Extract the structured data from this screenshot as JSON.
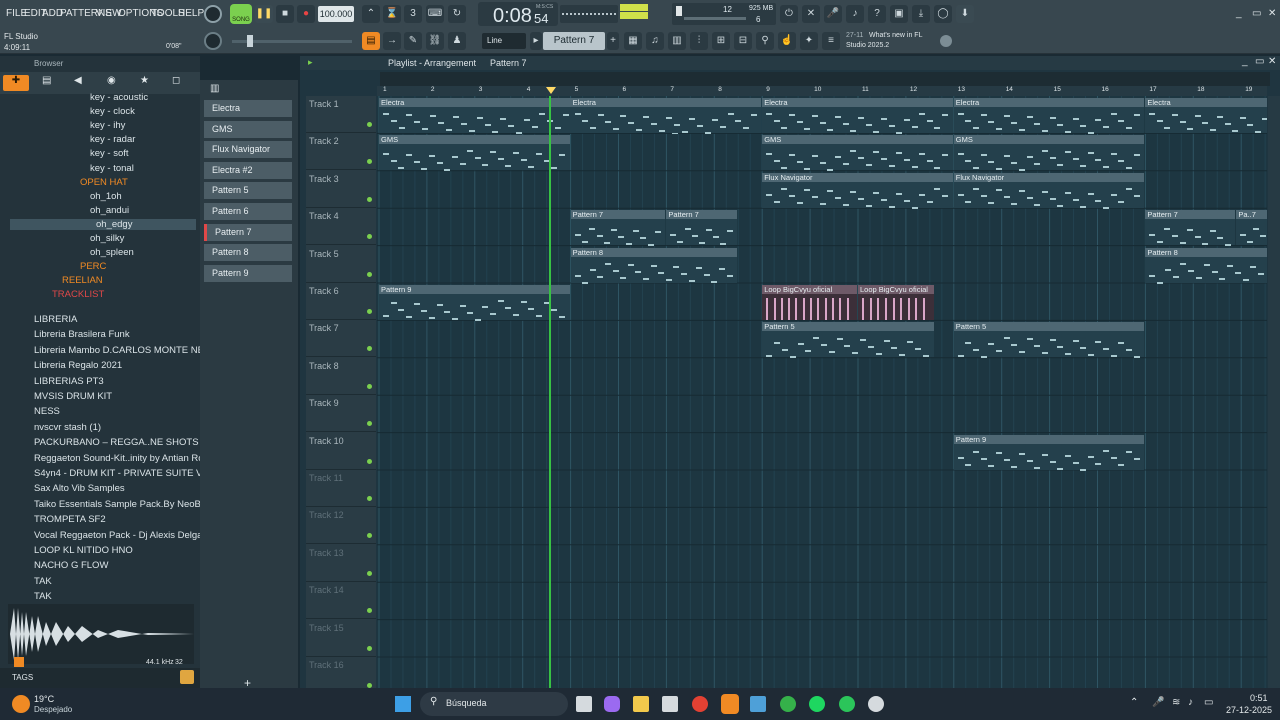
{
  "menu": [
    "FILE",
    "EDIT",
    "ADD",
    "PATTERNS",
    "VIEW",
    "OPTIONS",
    "TOOLS",
    "HELP"
  ],
  "transport": {
    "tempo": "100.000",
    "time": "0:08",
    "time_small": "54",
    "time_label": "M:S:CS",
    "cpu_a": "12",
    "ram": "925 MB",
    "cpu_b": "6",
    "song_label": "SONG"
  },
  "toolbar": {
    "snap": "Line",
    "pattern": "Pattern 7"
  },
  "news": {
    "date": "27-11",
    "text1": "What's new in FL",
    "text2": "Studio 2025.2"
  },
  "app": {
    "name": "FL Studio",
    "counter": "4:09:11",
    "hint": "0'08\""
  },
  "browser": {
    "title": "Browser",
    "items": [
      "key - acoustic",
      "key - clock",
      "key - ihy",
      "key - radar",
      "key - soft",
      "key - tonal",
      "OPEN HAT",
      "oh_1oh",
      "oh_andui",
      "oh_edgy",
      "oh_silky",
      "oh_spleen",
      "PERC",
      "REELIAN",
      "TRACKLIST",
      "LIBRERIA",
      "Libreria Brasilera Funk",
      "Libreria Mambo  D.CARLOS MONTE NEGRO",
      "Libreria Regalo 2021",
      "LIBRERIAS PT3",
      "MVSIS DRUM KIT",
      "NESS",
      "nvscvr stash (1)",
      "PACKURBANO – REGGA..NE SHOTS VOL. 03",
      "Reggaeton Sound-Kit..inity by Antian Rose",
      "S4yn4 - DRUM KIT - PRIVATE SUITE VOL.3",
      "Sax Alto Vib Samples",
      "Taiko Essentials Sample Pack.By NeoBeats",
      "TROMPETA SF2",
      "Vocal Reggaeton Pack - Dj Alexis Delgado",
      "LOOP KL NITIDO HNO",
      "NACHO G FLOW",
      "TAK",
      "TAK"
    ],
    "samplerate": "44.1 kHz",
    "bits": "32",
    "tags": "TAGS"
  },
  "channels": [
    "Electra",
    "GMS",
    "Flux Navigator",
    "Electra #2",
    "Pattern 5",
    "Pattern 6",
    "Pattern 7",
    "Pattern 8",
    "Pattern 9"
  ],
  "playlist": {
    "title": "Playlist - Arrangement",
    "pattern": "Pattern 7",
    "bars": [
      "1",
      "2",
      "3",
      "4",
      "5",
      "6",
      "7",
      "8",
      "9",
      "10",
      "11",
      "12",
      "13",
      "14",
      "15",
      "16",
      "17",
      "18",
      "19"
    ]
  },
  "tracks": [
    "Track 1",
    "Track 2",
    "Track 3",
    "Track 4",
    "Track 5",
    "Track 6",
    "Track 7",
    "Track 8",
    "Track 9",
    "Track 10",
    "Track 11",
    "Track 12",
    "Track 13",
    "Track 14",
    "Track 15",
    "Track 16"
  ],
  "clips": [
    {
      "label": "Electra",
      "track": 0,
      "start": 1,
      "len": 8
    },
    {
      "label": "Electra",
      "track": 0,
      "start": 5,
      "len": 4
    },
    {
      "label": "Electra",
      "track": 0,
      "start": 9,
      "len": 4
    },
    {
      "label": "Electra",
      "track": 0,
      "start": 13,
      "len": 4
    },
    {
      "label": "Electra",
      "track": 0,
      "start": 17,
      "len": 3
    },
    {
      "label": "GMS",
      "track": 1,
      "start": 1,
      "len": 4
    },
    {
      "label": "GMS",
      "track": 1,
      "start": 9,
      "len": 4
    },
    {
      "label": "GMS",
      "track": 1,
      "start": 13,
      "len": 4
    },
    {
      "label": "Flux Navigator",
      "track": 2,
      "start": 9,
      "len": 4
    },
    {
      "label": "Flux Navigator",
      "track": 2,
      "start": 13,
      "len": 4
    },
    {
      "label": "Pattern 7",
      "track": 3,
      "start": 5,
      "len": 2
    },
    {
      "label": "Pattern 7",
      "track": 3,
      "start": 7,
      "len": 1.5
    },
    {
      "label": "Pattern 7",
      "track": 3,
      "start": 17,
      "len": 1.9
    },
    {
      "label": "Pa..7",
      "track": 3,
      "start": 18.9,
      "len": 0.7
    },
    {
      "label": "Pattern 8",
      "track": 4,
      "start": 5,
      "len": 3.5
    },
    {
      "label": "Pattern 8",
      "track": 4,
      "start": 17,
      "len": 2.6
    },
    {
      "label": "Pattern 9",
      "track": 5,
      "start": 1,
      "len": 4
    },
    {
      "label": "Loop BigCvyu oficial",
      "track": 5,
      "start": 9,
      "len": 2
    },
    {
      "label": "Loop BigCvyu oficial",
      "track": 5,
      "start": 11,
      "len": 1.6
    },
    {
      "label": "Pattern 5",
      "track": 6,
      "start": 9,
      "len": 3.6
    },
    {
      "label": "Pattern 5",
      "track": 6,
      "start": 13,
      "len": 4
    },
    {
      "label": "Pattern 9",
      "track": 9,
      "start": 13,
      "len": 4
    }
  ],
  "taskbar": {
    "temp": "19°C",
    "weather": "Despejado",
    "search": "Búsqueda",
    "time": "0:51",
    "date": "27-12-2025"
  },
  "colors": {
    "accent": "#f08a24",
    "playhead": "#37c244",
    "clip_header": "#4e6773",
    "pink_loop": "#d9a6c8"
  }
}
